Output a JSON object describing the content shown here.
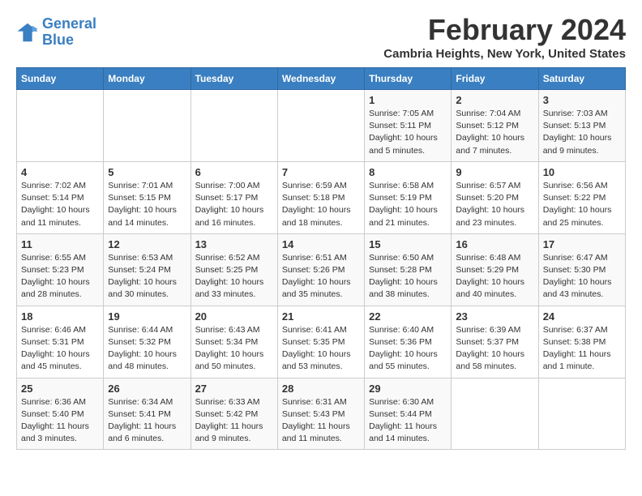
{
  "logo": {
    "text_general": "General",
    "text_blue": "Blue"
  },
  "title": "February 2024",
  "subtitle": "Cambria Heights, New York, United States",
  "header_days": [
    "Sunday",
    "Monday",
    "Tuesday",
    "Wednesday",
    "Thursday",
    "Friday",
    "Saturday"
  ],
  "weeks": [
    [
      {
        "day": "",
        "info": ""
      },
      {
        "day": "",
        "info": ""
      },
      {
        "day": "",
        "info": ""
      },
      {
        "day": "",
        "info": ""
      },
      {
        "day": "1",
        "info": "Sunrise: 7:05 AM\nSunset: 5:11 PM\nDaylight: 10 hours\nand 5 minutes."
      },
      {
        "day": "2",
        "info": "Sunrise: 7:04 AM\nSunset: 5:12 PM\nDaylight: 10 hours\nand 7 minutes."
      },
      {
        "day": "3",
        "info": "Sunrise: 7:03 AM\nSunset: 5:13 PM\nDaylight: 10 hours\nand 9 minutes."
      }
    ],
    [
      {
        "day": "4",
        "info": "Sunrise: 7:02 AM\nSunset: 5:14 PM\nDaylight: 10 hours\nand 11 minutes."
      },
      {
        "day": "5",
        "info": "Sunrise: 7:01 AM\nSunset: 5:15 PM\nDaylight: 10 hours\nand 14 minutes."
      },
      {
        "day": "6",
        "info": "Sunrise: 7:00 AM\nSunset: 5:17 PM\nDaylight: 10 hours\nand 16 minutes."
      },
      {
        "day": "7",
        "info": "Sunrise: 6:59 AM\nSunset: 5:18 PM\nDaylight: 10 hours\nand 18 minutes."
      },
      {
        "day": "8",
        "info": "Sunrise: 6:58 AM\nSunset: 5:19 PM\nDaylight: 10 hours\nand 21 minutes."
      },
      {
        "day": "9",
        "info": "Sunrise: 6:57 AM\nSunset: 5:20 PM\nDaylight: 10 hours\nand 23 minutes."
      },
      {
        "day": "10",
        "info": "Sunrise: 6:56 AM\nSunset: 5:22 PM\nDaylight: 10 hours\nand 25 minutes."
      }
    ],
    [
      {
        "day": "11",
        "info": "Sunrise: 6:55 AM\nSunset: 5:23 PM\nDaylight: 10 hours\nand 28 minutes."
      },
      {
        "day": "12",
        "info": "Sunrise: 6:53 AM\nSunset: 5:24 PM\nDaylight: 10 hours\nand 30 minutes."
      },
      {
        "day": "13",
        "info": "Sunrise: 6:52 AM\nSunset: 5:25 PM\nDaylight: 10 hours\nand 33 minutes."
      },
      {
        "day": "14",
        "info": "Sunrise: 6:51 AM\nSunset: 5:26 PM\nDaylight: 10 hours\nand 35 minutes."
      },
      {
        "day": "15",
        "info": "Sunrise: 6:50 AM\nSunset: 5:28 PM\nDaylight: 10 hours\nand 38 minutes."
      },
      {
        "day": "16",
        "info": "Sunrise: 6:48 AM\nSunset: 5:29 PM\nDaylight: 10 hours\nand 40 minutes."
      },
      {
        "day": "17",
        "info": "Sunrise: 6:47 AM\nSunset: 5:30 PM\nDaylight: 10 hours\nand 43 minutes."
      }
    ],
    [
      {
        "day": "18",
        "info": "Sunrise: 6:46 AM\nSunset: 5:31 PM\nDaylight: 10 hours\nand 45 minutes."
      },
      {
        "day": "19",
        "info": "Sunrise: 6:44 AM\nSunset: 5:32 PM\nDaylight: 10 hours\nand 48 minutes."
      },
      {
        "day": "20",
        "info": "Sunrise: 6:43 AM\nSunset: 5:34 PM\nDaylight: 10 hours\nand 50 minutes."
      },
      {
        "day": "21",
        "info": "Sunrise: 6:41 AM\nSunset: 5:35 PM\nDaylight: 10 hours\nand 53 minutes."
      },
      {
        "day": "22",
        "info": "Sunrise: 6:40 AM\nSunset: 5:36 PM\nDaylight: 10 hours\nand 55 minutes."
      },
      {
        "day": "23",
        "info": "Sunrise: 6:39 AM\nSunset: 5:37 PM\nDaylight: 10 hours\nand 58 minutes."
      },
      {
        "day": "24",
        "info": "Sunrise: 6:37 AM\nSunset: 5:38 PM\nDaylight: 11 hours\nand 1 minute."
      }
    ],
    [
      {
        "day": "25",
        "info": "Sunrise: 6:36 AM\nSunset: 5:40 PM\nDaylight: 11 hours\nand 3 minutes."
      },
      {
        "day": "26",
        "info": "Sunrise: 6:34 AM\nSunset: 5:41 PM\nDaylight: 11 hours\nand 6 minutes."
      },
      {
        "day": "27",
        "info": "Sunrise: 6:33 AM\nSunset: 5:42 PM\nDaylight: 11 hours\nand 9 minutes."
      },
      {
        "day": "28",
        "info": "Sunrise: 6:31 AM\nSunset: 5:43 PM\nDaylight: 11 hours\nand 11 minutes."
      },
      {
        "day": "29",
        "info": "Sunrise: 6:30 AM\nSunset: 5:44 PM\nDaylight: 11 hours\nand 14 minutes."
      },
      {
        "day": "",
        "info": ""
      },
      {
        "day": "",
        "info": ""
      }
    ]
  ]
}
